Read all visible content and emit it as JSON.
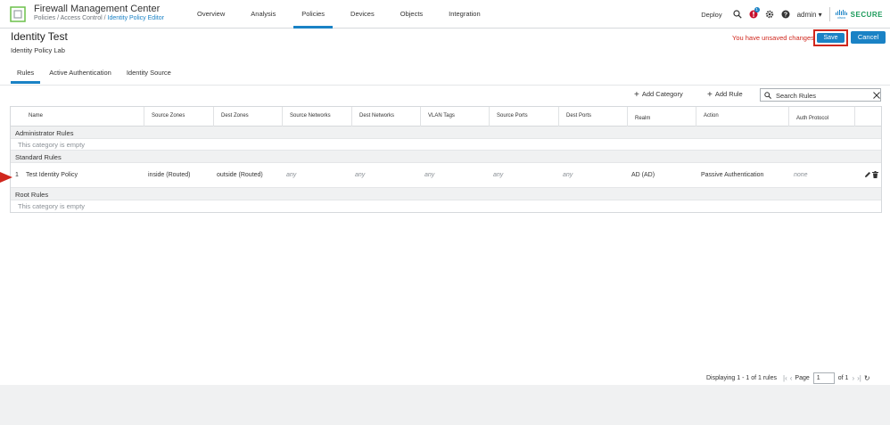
{
  "app": {
    "title": "Firewall Management Center",
    "breadcrumb": [
      "Policies",
      "Access Control",
      "Identity Policy Editor"
    ],
    "breadcrumb_sep": " / "
  },
  "nav": {
    "items": [
      "Overview",
      "Analysis",
      "Policies",
      "Devices",
      "Objects",
      "Integration"
    ],
    "active": "Policies"
  },
  "tools": {
    "deploy": "Deploy",
    "notification_count": "1",
    "user": "admin",
    "brand_small": "cisco",
    "brand": "SECURE"
  },
  "header": {
    "title": "Identity Test",
    "subtitle": "Identity Policy Lab",
    "unsaved": "You have unsaved changes",
    "save": "Save",
    "cancel": "Cancel"
  },
  "tabs": [
    "Rules",
    "Active Authentication",
    "Identity Source"
  ],
  "toolbar": {
    "add_category": "Add Category",
    "add_rule": "Add Rule",
    "search_placeholder": "Search Rules"
  },
  "table": {
    "columns": [
      "Name",
      "Source Zones",
      "Dest Zones",
      "Source Networks",
      "Dest Networks",
      "VLAN Tags",
      "Source Ports",
      "Dest Ports",
      "Realm",
      "Action",
      "Auth Protocol"
    ],
    "categories": [
      {
        "name": "Administrator Rules",
        "empty_text": "This category is empty",
        "rules": []
      },
      {
        "name": "Standard Rules",
        "empty_text": "",
        "rules": [
          {
            "num": "1",
            "name": "Test Identity Policy",
            "source_zones": "inside (Routed)",
            "dest_zones": "outside (Routed)",
            "source_networks": "any",
            "dest_networks": "any",
            "vlan_tags": "any",
            "source_ports": "any",
            "dest_ports": "any",
            "realm": "AD (AD)",
            "action": "Passive Authentication",
            "auth_protocol": "none"
          }
        ]
      },
      {
        "name": "Root Rules",
        "empty_text": "This category is empty",
        "rules": []
      }
    ]
  },
  "pagination": {
    "summary": "Displaying 1 - 1 of 1 rules",
    "page_label": "Page",
    "page_value": "1",
    "of_label": "of 1"
  },
  "colors": {
    "accent": "#1a82c5",
    "alert": "#d0271d",
    "brand_green": "#1a9a5a"
  }
}
